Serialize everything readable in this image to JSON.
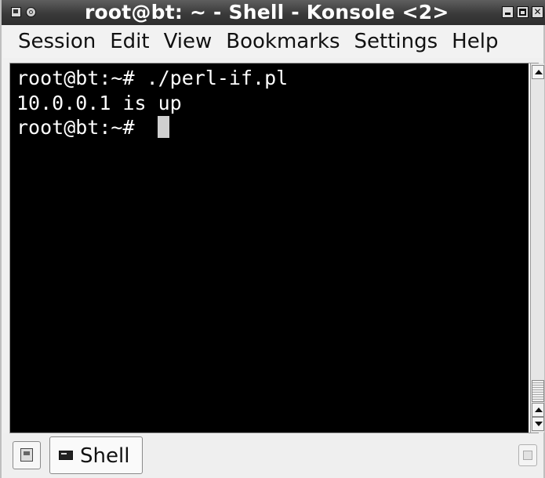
{
  "window": {
    "title": "root@bt: ~ - Shell - Konsole <2>"
  },
  "menubar": {
    "items": [
      "Session",
      "Edit",
      "View",
      "Bookmarks",
      "Settings",
      "Help"
    ]
  },
  "terminal": {
    "lines": [
      "root@bt:~# ./perl-if.pl",
      "10.0.0.1 is up",
      "root@bt:~# "
    ]
  },
  "tabbar": {
    "tabs": [
      {
        "label": "Shell",
        "icon": "terminal-icon",
        "active": true
      }
    ]
  },
  "icons": {
    "window_menu": "window-menu-icon",
    "sticky": "sticky-icon",
    "minimize": "minimize-icon",
    "maximize": "maximize-icon",
    "close": "close-icon",
    "new_tab": "new-tab-icon",
    "close_tab": "close-tab-icon"
  },
  "colors": {
    "terminal_background": "#000000",
    "terminal_text": "#ffffff",
    "titlebar": "#3a3a3a"
  }
}
